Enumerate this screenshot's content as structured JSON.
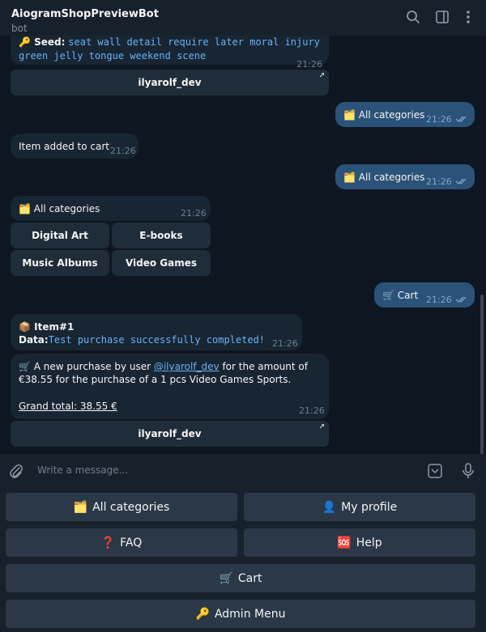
{
  "header": {
    "title": "AiogramShopPreviewBot",
    "subtitle": "bot"
  },
  "messages": {
    "seed": {
      "label": "🔑 Seed:",
      "line1": "seat wall detail require later moral injury",
      "line2": "green jelly tongue weekend scene",
      "time": "21:26",
      "button": "ilyarolf_dev"
    },
    "out_all_categories_1": {
      "emoji": "🗂️",
      "text": "All categories",
      "time": "21:26"
    },
    "item_added": {
      "text": "Item added to cart",
      "time": "21:26"
    },
    "out_all_categories_2": {
      "emoji": "🗂️",
      "text": "All categories",
      "time": "21:26"
    },
    "categories": {
      "emoji": "🗂️",
      "text": "All categories",
      "time": "21:26",
      "buttons": [
        "Digital Art",
        "E-books",
        "Music Albums",
        "Video Games"
      ]
    },
    "out_cart": {
      "emoji": "🛒",
      "text": "Cart",
      "time": "21:26"
    },
    "item": {
      "emoji": "📦",
      "title": "Item#1",
      "data_label": "Data:",
      "data_value": "Test purchase successfully completed!",
      "time": "21:26"
    },
    "purchase": {
      "emoji": "🛒",
      "text_a": "A new purchase by user ",
      "user": "@ilyarolf_dev",
      "text_b": " for the amount of",
      "line2": "€38.55 for the purchase of a 1 pcs Video Games Sports.",
      "total": "Grand total: 38.55 €",
      "time": "21:26",
      "button": "ilyarolf_dev"
    }
  },
  "input": {
    "placeholder": "Write a message..."
  },
  "reply_keyboard": {
    "all_categories": {
      "emoji": "🗂️",
      "label": "All categories"
    },
    "my_profile": {
      "emoji": "👤",
      "label": "My profile"
    },
    "faq": {
      "emoji": "❓",
      "label": "FAQ"
    },
    "help": {
      "emoji": "🆘",
      "label": "Help"
    },
    "cart": {
      "emoji": "🛒",
      "label": "Cart"
    },
    "admin_menu": {
      "emoji": "🔑",
      "label": "Admin Menu"
    }
  },
  "colors": {
    "background": "#0e1621",
    "incoming": "#182533",
    "outgoing": "#2b5278",
    "link": "#6ab2f2"
  }
}
